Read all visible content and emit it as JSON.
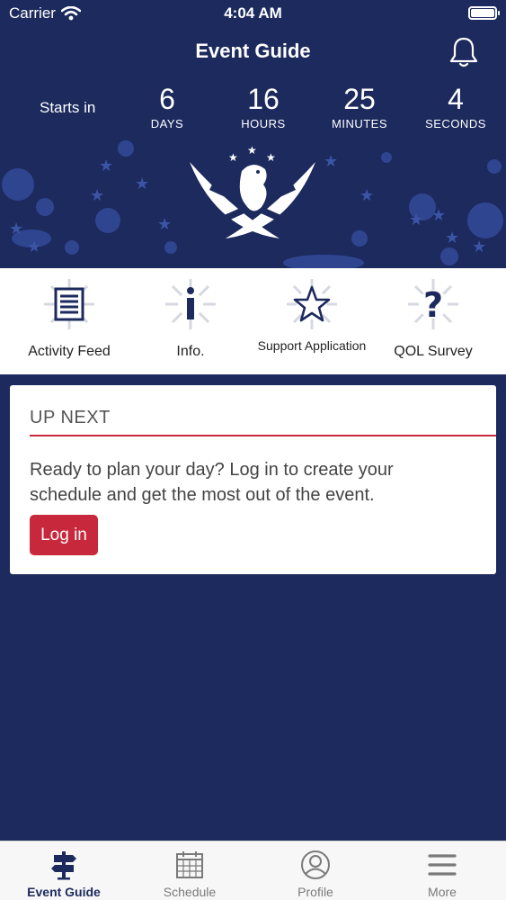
{
  "status": {
    "carrier": "Carrier",
    "time": "4:04 AM"
  },
  "nav": {
    "title": "Event Guide"
  },
  "countdown": {
    "label": "Starts in",
    "items": [
      {
        "value": "6",
        "unit": "DAYS"
      },
      {
        "value": "16",
        "unit": "HOURS"
      },
      {
        "value": "25",
        "unit": "MINUTES"
      },
      {
        "value": "4",
        "unit": "SECONDS"
      }
    ]
  },
  "quick_links": [
    {
      "label": "Activity Feed",
      "icon": "document-icon"
    },
    {
      "label": "Info.",
      "icon": "info-icon"
    },
    {
      "label": "Support Application",
      "icon": "star-icon"
    },
    {
      "label": "QOL Survey",
      "icon": "question-icon"
    }
  ],
  "up_next": {
    "title": "UP NEXT",
    "message": "Ready to plan your day? Log in to create your schedule and get the most out of the event.",
    "login_label": "Log in"
  },
  "tabs": [
    {
      "label": "Event Guide",
      "icon": "signpost-icon",
      "active": true
    },
    {
      "label": "Schedule",
      "icon": "calendar-icon",
      "active": false
    },
    {
      "label": "Profile",
      "icon": "profile-icon",
      "active": false
    },
    {
      "label": "More",
      "icon": "menu-icon",
      "active": false
    }
  ],
  "colors": {
    "navy": "#1c2a5e",
    "accent_red": "#c8283c",
    "tab_active": "#1c2a5e",
    "tab_inactive": "#7a7a7a"
  }
}
